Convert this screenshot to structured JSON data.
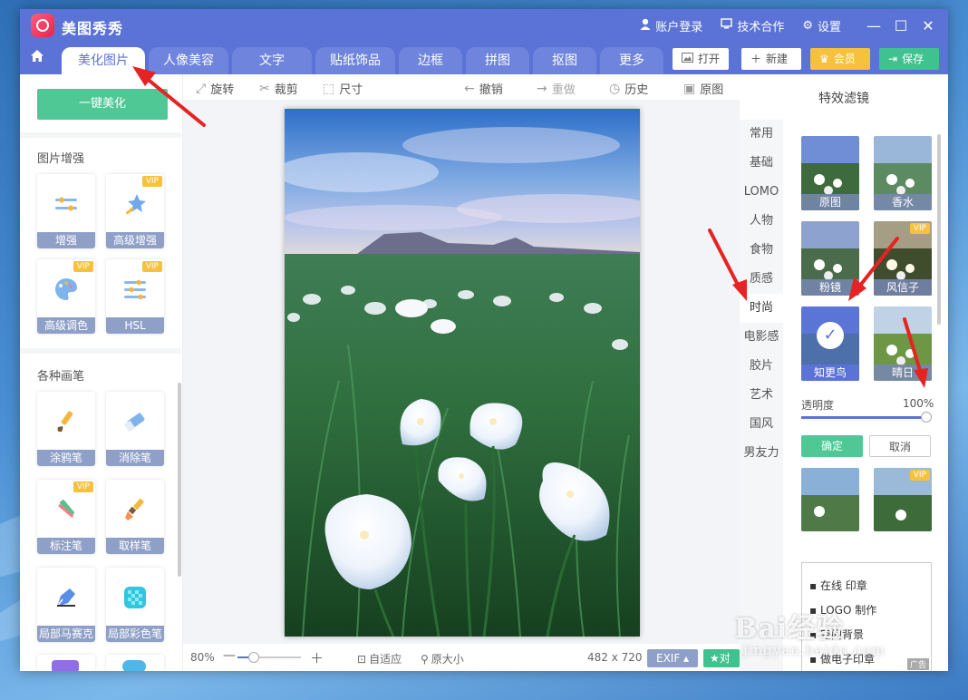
{
  "app": {
    "title": "美图秀秀",
    "account_login": "账户登录",
    "tech_coop": "技术合作",
    "settings": "设置",
    "win_min": "—",
    "win_max": "☐",
    "win_close": "✕"
  },
  "tabs": {
    "home_icon": "home-icon",
    "items": [
      "美化图片",
      "人像美容",
      "文字",
      "贴纸饰品",
      "边框",
      "拼图",
      "抠图",
      "更多"
    ],
    "open": "打开",
    "new": "新建",
    "vip": "会员",
    "save": "保存"
  },
  "left": {
    "one_key": "一键美化",
    "section1": "图片增强",
    "section2": "各种画笔",
    "vip_tag": "VIP",
    "tools": [
      "增强",
      "高级增强",
      "高级调色",
      "HSL",
      "涂鸦笔",
      "消除笔",
      "标注笔",
      "取样笔",
      "局部马赛克",
      "局部彩色笔"
    ]
  },
  "edit_toolbar": {
    "rotate": "旋转",
    "crop": "裁剪",
    "size": "尺寸",
    "undo": "撤销",
    "redo": "重做",
    "history": "历史",
    "original": "原图"
  },
  "status": {
    "zoom": "80%",
    "zoom_level": 0.25,
    "fit": "自适应",
    "actual": "原大小",
    "dimensions": "482 x 720",
    "exif": "EXIF ▴",
    "compare": "对比"
  },
  "right": {
    "title": "特效滤镜",
    "categories": [
      "常用",
      "基础",
      "LOMO",
      "人物",
      "食物",
      "质感",
      "时尚",
      "电影感",
      "胶片",
      "艺术",
      "国风",
      "男友力"
    ],
    "active_category": "时尚",
    "filters": [
      "原图",
      "香水",
      "粉镜",
      "风信子",
      "知更鸟",
      "晴日"
    ],
    "selected_filter": "知更鸟",
    "opacity_label": "透明度",
    "opacity_value": "100%",
    "ok": "确定",
    "cancel": "取消",
    "ad_lines": [
      "在线 印章",
      "LOGO 制作",
      "空间背景",
      "做电子印章"
    ],
    "ad_tag": "广告"
  },
  "watermark": {
    "brand": "Bai经验",
    "url": "jingyan.baidu.com"
  }
}
